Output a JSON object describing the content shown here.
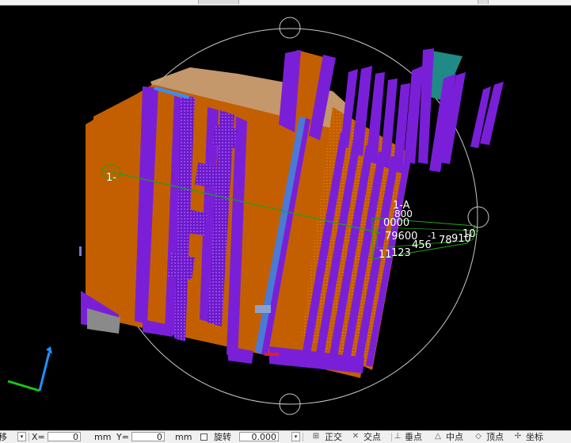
{
  "viewport": {
    "axis_labels": [
      "1-",
      "1-A"
    ],
    "dimension_texts": [
      "800",
      "0000",
      "79600",
      "-1",
      "10",
      "11",
      "123",
      "456",
      "78",
      "910"
    ],
    "colors": {
      "background": "#000000",
      "column_orange": "#c35f00",
      "wall_purple": "#7a1fd8",
      "wall_purple_light": "#9a46f0",
      "teal": "#1f8a86",
      "grey_block": "#8a8a8a",
      "orbit_circle": "#c8c8c8",
      "grid_green": "#1fa01f",
      "axis_z": "#1e90ff",
      "axis_x": "#18c818"
    }
  },
  "statusbar": {
    "mode_label": "移",
    "x_label": "X=",
    "x_value": "0",
    "x_unit": "mm",
    "y_label": "Y=",
    "y_value": "0",
    "y_unit": "mm",
    "rotate_label": "旋转",
    "rotate_value": "0.000",
    "ortho_label": "正交",
    "intersection_label": "交点",
    "perpendicular_label": "垂点",
    "midpoint_label": "中点",
    "vertex_label": "顶点",
    "coordinate_label": "坐标"
  },
  "icons": {
    "ortho": "ortho-grid-icon",
    "intersection": "intersection-icon",
    "perpendicular": "perpendicular-icon",
    "midpoint": "midpoint-icon",
    "vertex": "vertex-icon",
    "coordinate": "coordinate-icon"
  }
}
